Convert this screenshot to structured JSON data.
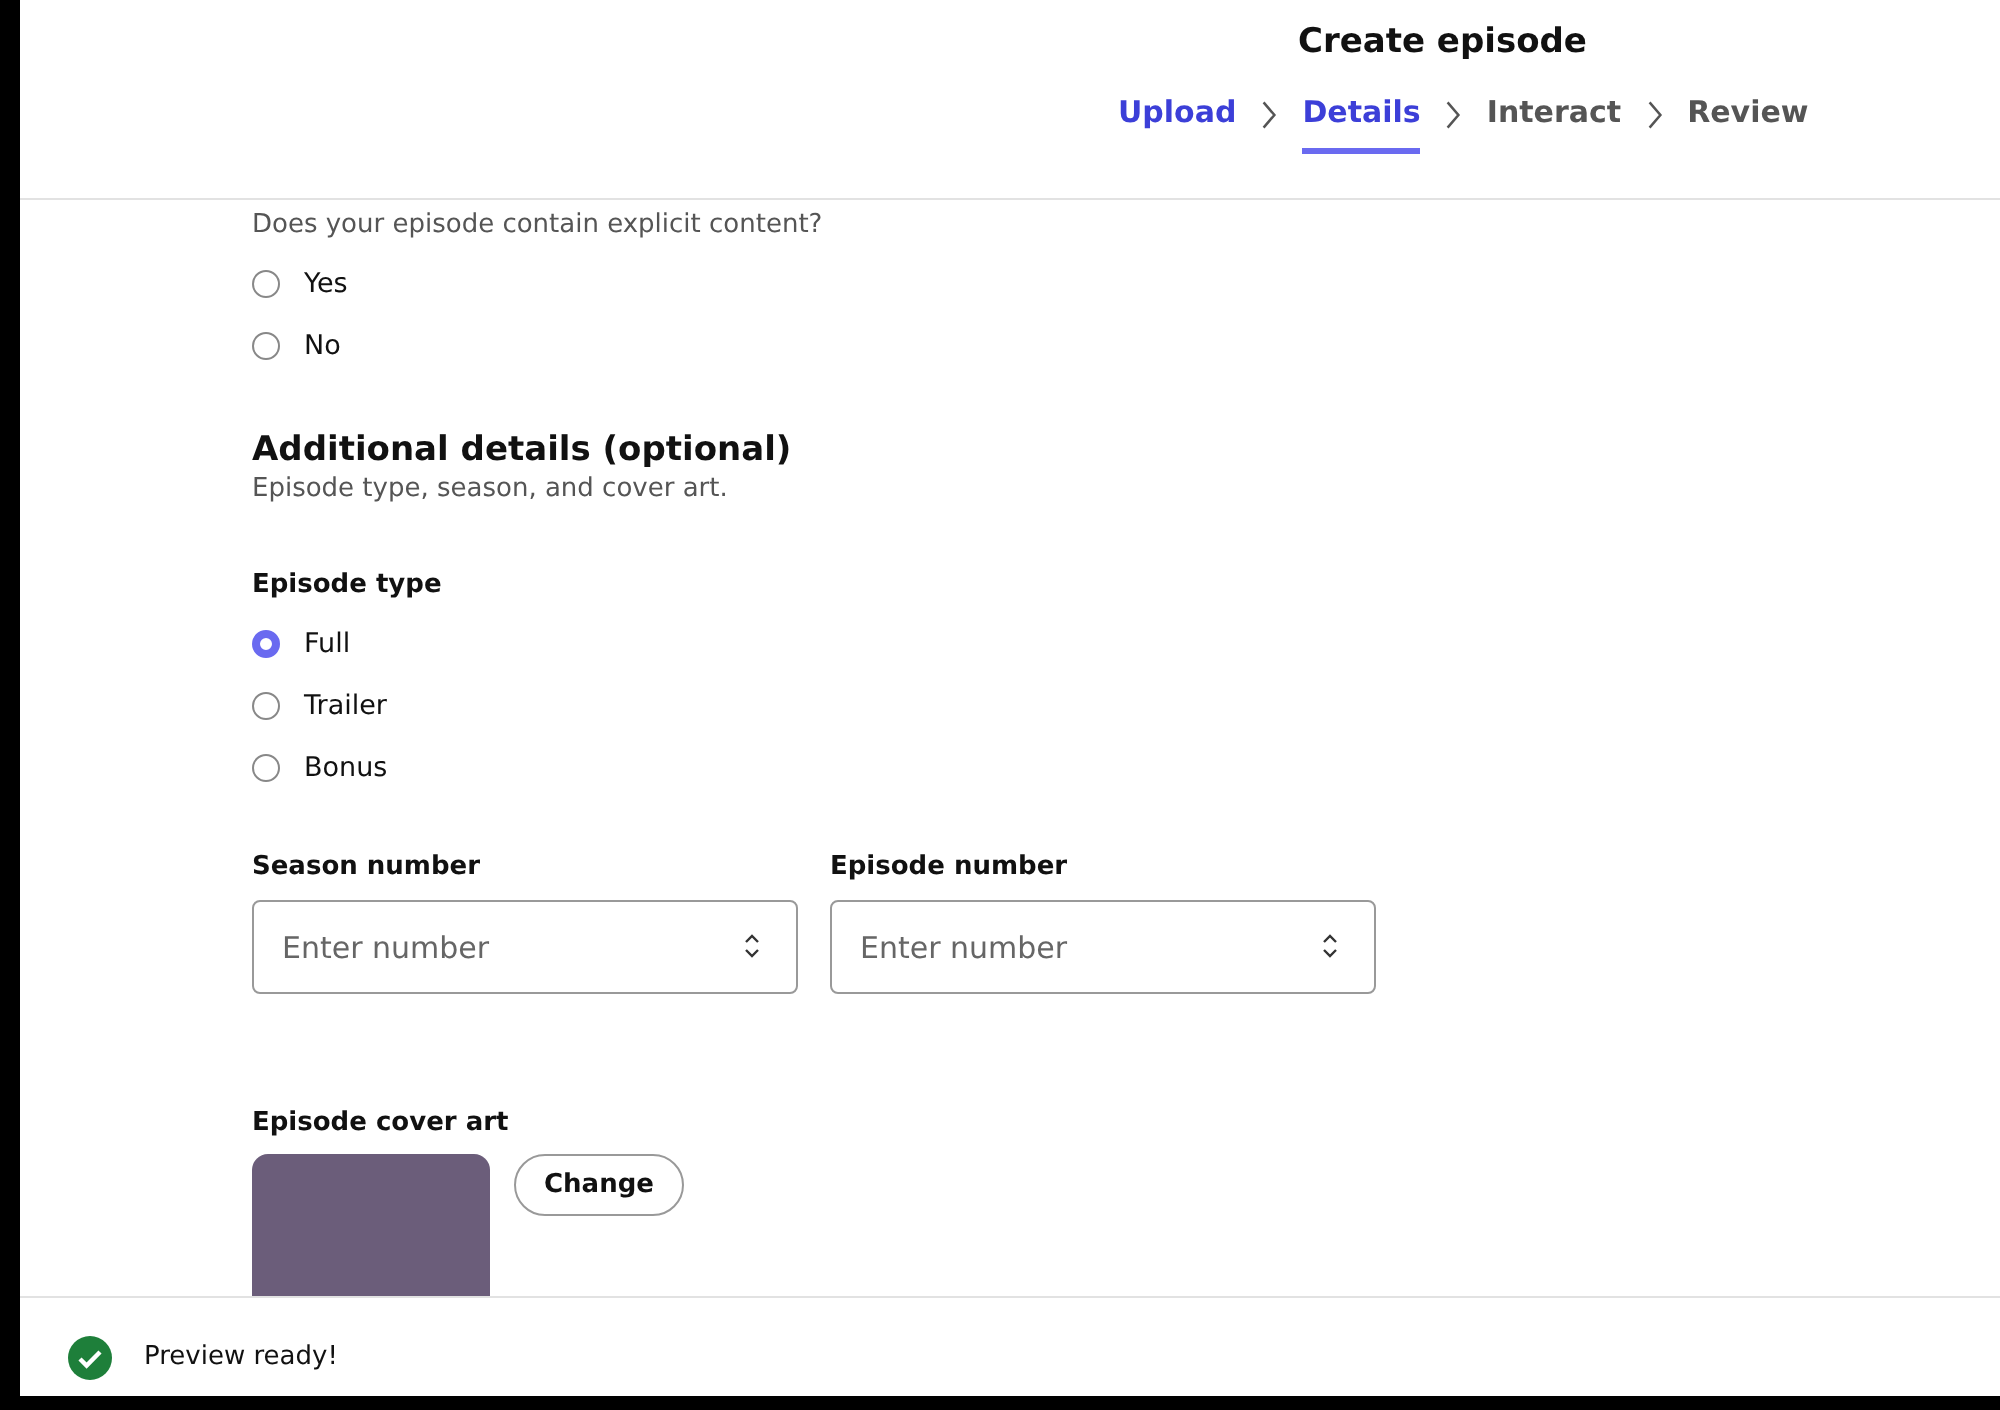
{
  "header": {
    "title": "Create episode",
    "steps": [
      {
        "label": "Upload",
        "selected": false,
        "completed": true
      },
      {
        "label": "Details",
        "selected": true,
        "completed": false
      },
      {
        "label": "Interact",
        "selected": false,
        "completed": false
      },
      {
        "label": "Review",
        "selected": false,
        "completed": false
      }
    ]
  },
  "explicit": {
    "question": "Does your episode contain explicit content?",
    "options": [
      {
        "label": "Yes",
        "selected": false
      },
      {
        "label": "No",
        "selected": false
      }
    ]
  },
  "additional": {
    "heading": "Additional details (optional)",
    "subtitle": "Episode type, season, and cover art."
  },
  "episode_type": {
    "label": "Episode type",
    "options": [
      {
        "label": "Full",
        "selected": true
      },
      {
        "label": "Trailer",
        "selected": false
      },
      {
        "label": "Bonus",
        "selected": false
      }
    ]
  },
  "number_fields": [
    {
      "label": "Season number",
      "placeholder": "Enter number"
    },
    {
      "label": "Episode number",
      "placeholder": "Enter number"
    }
  ],
  "cover_art": {
    "label": "Episode cover art",
    "button": "Change"
  },
  "status_bar": {
    "message": "Preview ready!"
  }
}
